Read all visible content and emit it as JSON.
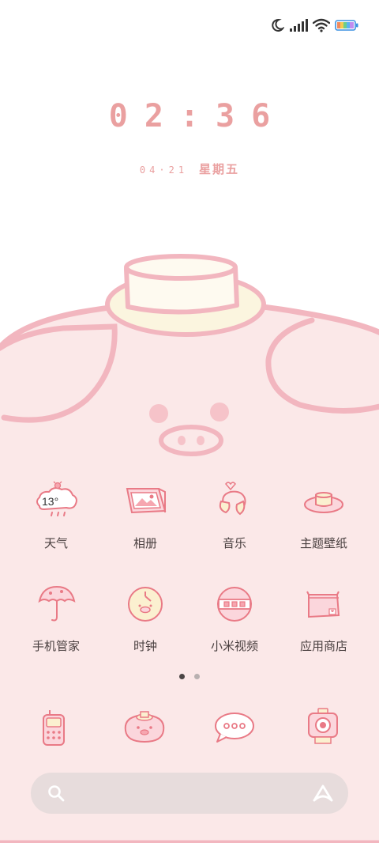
{
  "status_bar": {
    "icons": [
      "moon-icon",
      "signal-icon",
      "wifi-icon",
      "battery-icon"
    ]
  },
  "lock": {
    "time": "02:36",
    "date": "04·21",
    "weekday": "星期五"
  },
  "colors": {
    "accent": "#eaa0a0",
    "wallpaper_pink": "#fbe8e8",
    "outline_pink": "#f2b6bf",
    "hat_cream": "#fbf5df",
    "label": "#4a4040",
    "search_bg": "#e7dcdc"
  },
  "apps": {
    "weather": {
      "label": "天气",
      "temp": "13°",
      "icon": "weather-icon"
    },
    "gallery": {
      "label": "相册",
      "icon": "photo-frame-icon"
    },
    "music": {
      "label": "音乐",
      "icon": "headphones-icon"
    },
    "themes": {
      "label": "主题壁纸",
      "icon": "hat-icon"
    },
    "security": {
      "label": "手机管家",
      "icon": "umbrella-icon"
    },
    "clock": {
      "label": "时钟",
      "icon": "clock-face-icon"
    },
    "video": {
      "label": "小米视频",
      "icon": "ball-icon"
    },
    "store": {
      "label": "应用商店",
      "icon": "bag-icon"
    }
  },
  "pagination": {
    "pages": 2,
    "current": 1
  },
  "dock": [
    {
      "name": "phone",
      "icon": "phone-icon"
    },
    {
      "name": "browser",
      "icon": "pig-icon"
    },
    {
      "name": "messages",
      "icon": "chat-bubble-icon"
    },
    {
      "name": "camera",
      "icon": "camera-icon"
    }
  ],
  "search": {
    "placeholder": "",
    "icon": "search-icon",
    "assistant_icon": "assistant-icon"
  }
}
